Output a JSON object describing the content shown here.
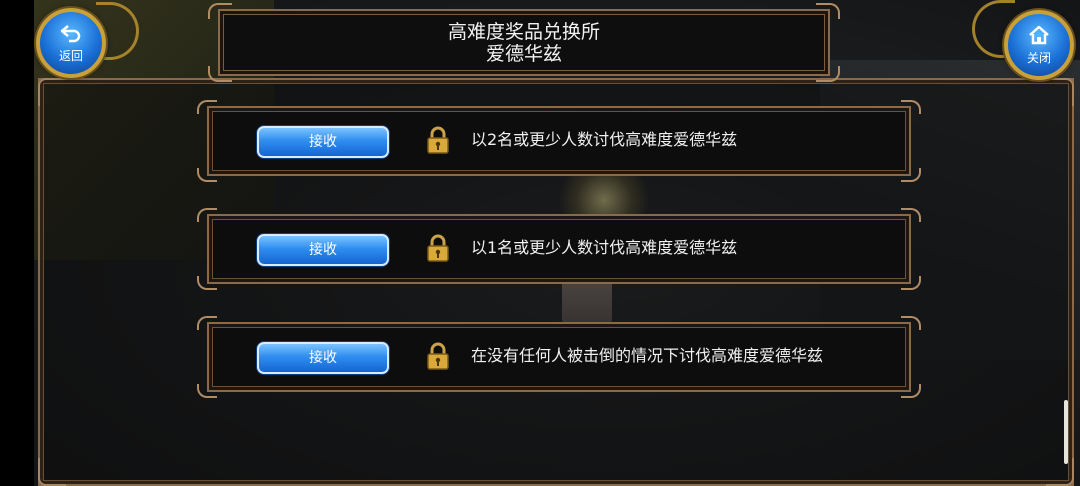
{
  "header": {
    "title_line1": "高难度奖品兑换所",
    "title_line2": "爱德华兹"
  },
  "nav": {
    "back_label": "返回",
    "close_label": "关闭"
  },
  "rewards": [
    {
      "button_label": "接收",
      "condition": "以2名或更少人数讨伐高难度爱德华兹",
      "locked": true
    },
    {
      "button_label": "接收",
      "condition": "以1名或更少人数讨伐高难度爱德华兹",
      "locked": true
    },
    {
      "button_label": "接收",
      "condition": "在没有任何人被击倒的情况下讨伐高难度爱德华兹",
      "locked": true
    }
  ],
  "colors": {
    "frame": "#8a6a48",
    "button_blue": "#2f8ef0",
    "lock_gold": "#d9a93a"
  }
}
